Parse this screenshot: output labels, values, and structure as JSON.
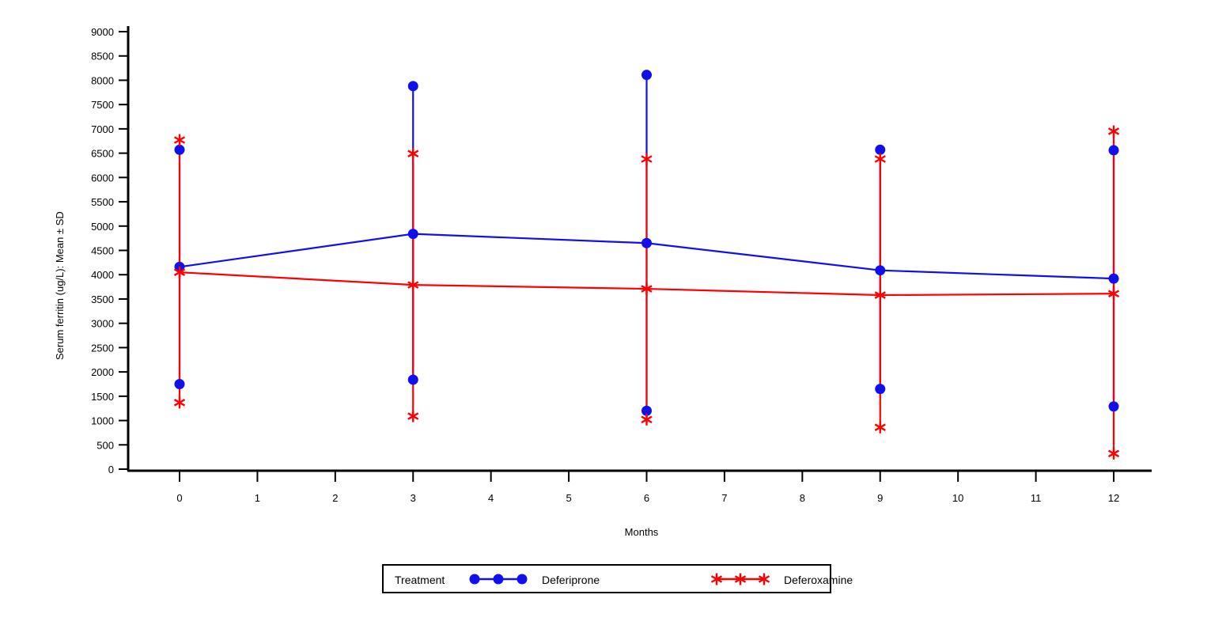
{
  "chart_data": {
    "type": "line",
    "title": "",
    "xlabel": "Months",
    "ylabel": "Serum ferritin (ug/L): Mean ± SD",
    "x": [
      0,
      3,
      6,
      9,
      12
    ],
    "xticks": [
      0,
      1,
      2,
      3,
      4,
      5,
      6,
      7,
      8,
      9,
      10,
      11,
      12
    ],
    "xlim": [
      -0.66,
      12.48
    ],
    "yticks": [
      0,
      500,
      1000,
      1500,
      2000,
      2500,
      3000,
      3500,
      4000,
      4500,
      5000,
      5500,
      6000,
      6500,
      7000,
      7500,
      8000,
      8500,
      9000
    ],
    "ylim": [
      0,
      9000
    ],
    "grid": false,
    "error_bars": "mean ± SD",
    "legend_title": "Treatment",
    "legend_position": "bottom",
    "series": [
      {
        "name": "Deferiprone",
        "color": "#1010EE",
        "marker": "circle",
        "x": [
          0,
          3,
          6,
          9,
          12
        ],
        "values": [
          4160,
          4840,
          4650,
          4090,
          3920
        ],
        "upper": [
          6570,
          7880,
          8110,
          6570,
          6560
        ],
        "lower": [
          1750,
          1840,
          1200,
          1650,
          1290
        ],
        "sd": [
          2410,
          3040,
          3460,
          2480,
          3270
        ]
      },
      {
        "name": "Deferoxamine",
        "color": "#FE0000",
        "marker": "asterisk",
        "x": [
          0,
          3,
          6,
          9,
          12
        ],
        "values": [
          4050,
          3790,
          3710,
          3580,
          3610
        ],
        "upper": [
          6770,
          6490,
          6380,
          6380,
          6950
        ],
        "lower": [
          1370,
          1090,
          1020,
          860,
          320
        ],
        "sd": [
          2700,
          2700,
          2670,
          2800,
          3315
        ]
      }
    ]
  },
  "legend": {
    "title": "Treatment",
    "entries": [
      {
        "label": "Deferiprone",
        "color": "#1010EE",
        "marker": "circle"
      },
      {
        "label": "Deferoxamine",
        "color": "#FE0000",
        "marker": "asterisk"
      }
    ]
  },
  "axes": {
    "y_title": "Serum ferritin (ug/L): Mean ± SD",
    "x_title": "Months",
    "y_tick_labels": [
      "9000",
      "8500",
      "8000",
      "7500",
      "7000",
      "6500",
      "6000",
      "5500",
      "5000",
      "4500",
      "4000",
      "3500",
      "3000",
      "2500",
      "2000",
      "1500",
      "1000",
      "500",
      "0"
    ],
    "x_tick_labels": [
      "0",
      "1",
      "2",
      "3",
      "4",
      "5",
      "6",
      "7",
      "8",
      "9",
      "10",
      "11",
      "12"
    ]
  }
}
